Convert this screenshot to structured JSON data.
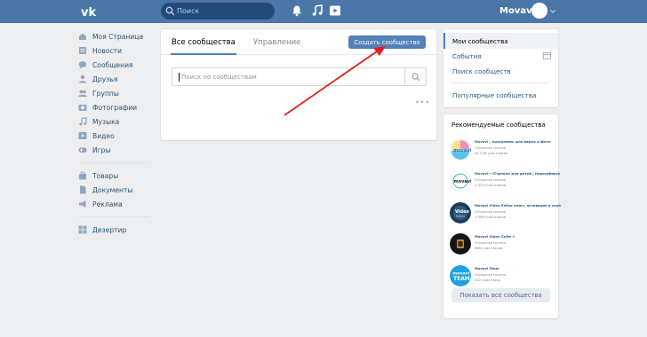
{
  "header": {
    "search_placeholder": "Поиск",
    "username": "Movavi",
    "icons": [
      "vk-logo-icon",
      "search-icon",
      "bell-icon",
      "music-icon",
      "video-icon",
      "chevron-down-icon"
    ]
  },
  "sidebar": {
    "items": [
      {
        "label": "Моя Страница",
        "icon": "home-icon"
      },
      {
        "label": "Новости",
        "icon": "news-icon"
      },
      {
        "label": "Сообщения",
        "icon": "message-icon"
      },
      {
        "label": "Друзья",
        "icon": "friends-icon"
      },
      {
        "label": "Группы",
        "icon": "groups-icon"
      },
      {
        "label": "Фотографии",
        "icon": "photo-icon"
      },
      {
        "label": "Музыка",
        "icon": "music-icon"
      },
      {
        "label": "Видео",
        "icon": "video-icon"
      },
      {
        "label": "Игры",
        "icon": "games-icon"
      }
    ],
    "items2": [
      {
        "label": "Товары",
        "icon": "bag-icon"
      },
      {
        "label": "Документы",
        "icon": "document-icon"
      },
      {
        "label": "Реклама",
        "icon": "megaphone-icon"
      }
    ],
    "items3": [
      {
        "label": "Дезертир",
        "icon": "apps-icon"
      }
    ]
  },
  "main": {
    "tabs": [
      {
        "label": "Все сообщества",
        "active": true
      },
      {
        "label": "Управление",
        "active": false
      }
    ],
    "create_button": "Создать сообщество",
    "search_placeholder": "Поиск по сообществам"
  },
  "right_menu": {
    "items": [
      {
        "label": "Мои сообщества",
        "active": true
      },
      {
        "label": "События"
      },
      {
        "label": "Поиск сообществ"
      },
      {
        "label": "Популярные сообщества"
      }
    ]
  },
  "recommended": {
    "title": "Рекомендуемые сообщества",
    "items": [
      {
        "name": "Movavi – программы для видео и фото",
        "type": "Открытая группа",
        "count": "94 248 участников"
      },
      {
        "name": "Movavi • IT-школа для детей | Новосибирск",
        "type": "Открытая группа",
        "count": "1 029 участников"
      },
      {
        "name": "Movavi Video Editor ключ, активация и спой",
        "type": "Открытая группа",
        "count": "1 596 участников"
      },
      {
        "name": "Movavi Video Suite +",
        "type": "Открытая группа",
        "count": "666 участников"
      },
      {
        "name": "Movavi Team",
        "type": "Открытая группа",
        "count": "202 участника"
      }
    ],
    "show_all": "Показать все сообщества"
  },
  "colors": {
    "header": "#4a76a8",
    "accent": "#5181b8",
    "background": "#edeef0",
    "arrow": "#e02020"
  }
}
